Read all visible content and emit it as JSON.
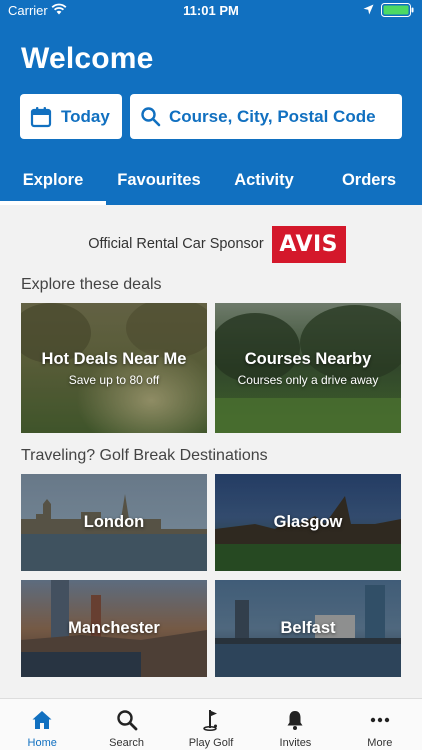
{
  "status_bar": {
    "carrier": "Carrier",
    "time": "11:01 PM"
  },
  "header": {
    "title": "Welcome",
    "date_label": "Today",
    "search_placeholder": "Course, City, Postal Code",
    "accent_color": "#1170c0"
  },
  "tabs": [
    {
      "label": "Explore",
      "active": true
    },
    {
      "label": "Favourites",
      "active": false
    },
    {
      "label": "Activity",
      "active": false
    },
    {
      "label": "Orders",
      "active": false
    }
  ],
  "sponsor": {
    "text": "Official Rental Car Sponsor",
    "brand": "AVIS",
    "brand_color": "#d4182b"
  },
  "deals": {
    "title": "Explore these deals",
    "items": [
      {
        "title": "Hot Deals Near Me",
        "subtitle": "Save up to 80 off"
      },
      {
        "title": "Courses Nearby",
        "subtitle": "Courses only a drive away"
      }
    ]
  },
  "destinations": {
    "title": "Traveling? Golf Break Destinations",
    "items": [
      {
        "title": "London"
      },
      {
        "title": "Glasgow"
      },
      {
        "title": "Manchester"
      },
      {
        "title": "Belfast"
      }
    ]
  },
  "bottom_nav": [
    {
      "label": "Home",
      "icon": "home-icon",
      "active": true
    },
    {
      "label": "Search",
      "icon": "search-icon",
      "active": false
    },
    {
      "label": "Play Golf",
      "icon": "golf-flag-icon",
      "active": false
    },
    {
      "label": "Invites",
      "icon": "bell-icon",
      "active": false
    },
    {
      "label": "More",
      "icon": "more-dots-icon",
      "active": false
    }
  ]
}
